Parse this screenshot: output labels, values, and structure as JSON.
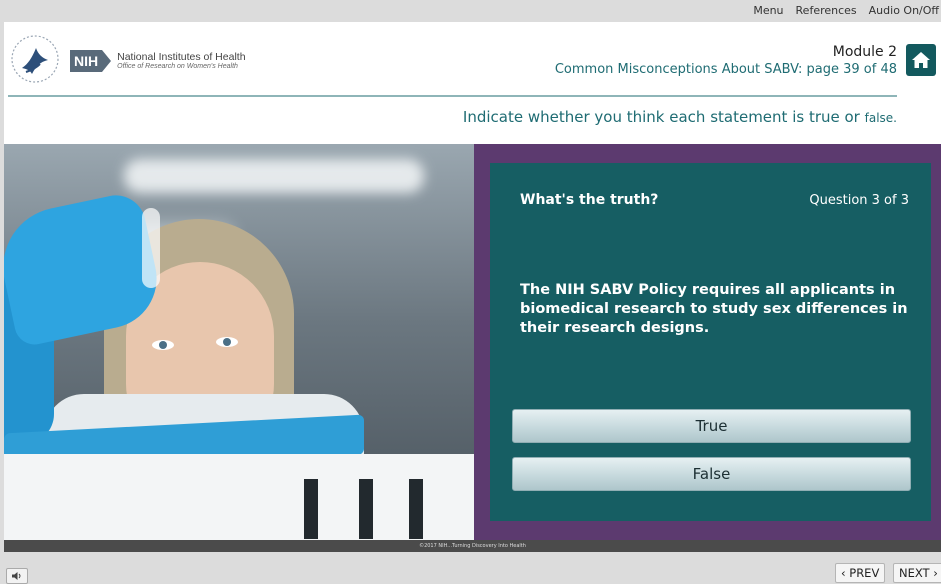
{
  "topmenu": {
    "menu": "Menu",
    "references": "References",
    "audio": "Audio On/Off"
  },
  "header": {
    "org_abbrev": "NIH",
    "org_name": "National Institutes of Health",
    "org_office": "Office of Research on Women's Health",
    "module_title": "Module 2",
    "module_page": "Common Misconceptions About SABV: page 39 of 48",
    "home_icon": "home-icon"
  },
  "instruction": {
    "text": "Indicate whether you think each statement is true or",
    "small": "false."
  },
  "quiz": {
    "title": "What's the truth?",
    "count": "Question 3 of 3",
    "statement": "The NIH SABV Policy requires all applicants in biomedical research to study sex differences in their research designs.",
    "answers": [
      "True",
      "False"
    ]
  },
  "footer": {
    "copyright": "©2017 NIH...Turning Discovery Into Health",
    "prev": "‹ PREV",
    "next": "NEXT ›"
  },
  "colors": {
    "teal": "#165e63",
    "purple": "#5c3a6f",
    "accent_text": "#1f6c73"
  }
}
